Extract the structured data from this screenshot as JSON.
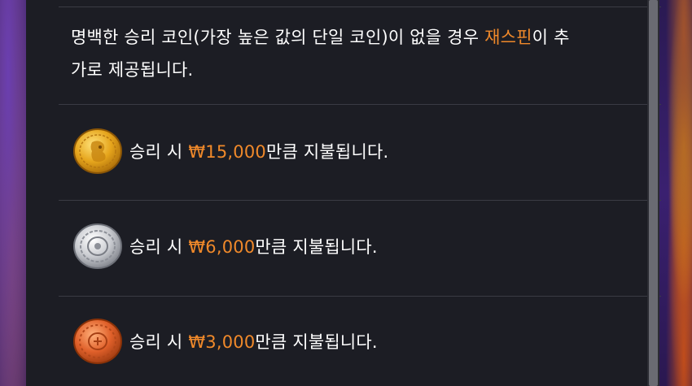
{
  "rules": {
    "paragraph_prefix": "명백한 승리 코인(가장 높은 값의 단일 코인)이 없을 경우 ",
    "paragraph_highlight": "재스핀",
    "paragraph_suffix_line1": "이 추",
    "paragraph_line2": "가로 제공됩니다."
  },
  "payouts": [
    {
      "coin": "gold-coin",
      "prefix": "승리 시 ",
      "amount": "₩15,000",
      "suffix": "만큼 지불됩니다."
    },
    {
      "coin": "silver-coin",
      "prefix": "승리 시 ",
      "amount": "₩6,000",
      "suffix": "만큼 지불됩니다."
    },
    {
      "coin": "bronze-coin",
      "prefix": "승리 시 ",
      "amount": "₩3,000",
      "suffix": "만큼 지불됩니다."
    }
  ],
  "colors": {
    "highlight": "#f0892a",
    "panel": "#1c1d24",
    "text": "#ffffff",
    "divider": "#3a3b44"
  }
}
